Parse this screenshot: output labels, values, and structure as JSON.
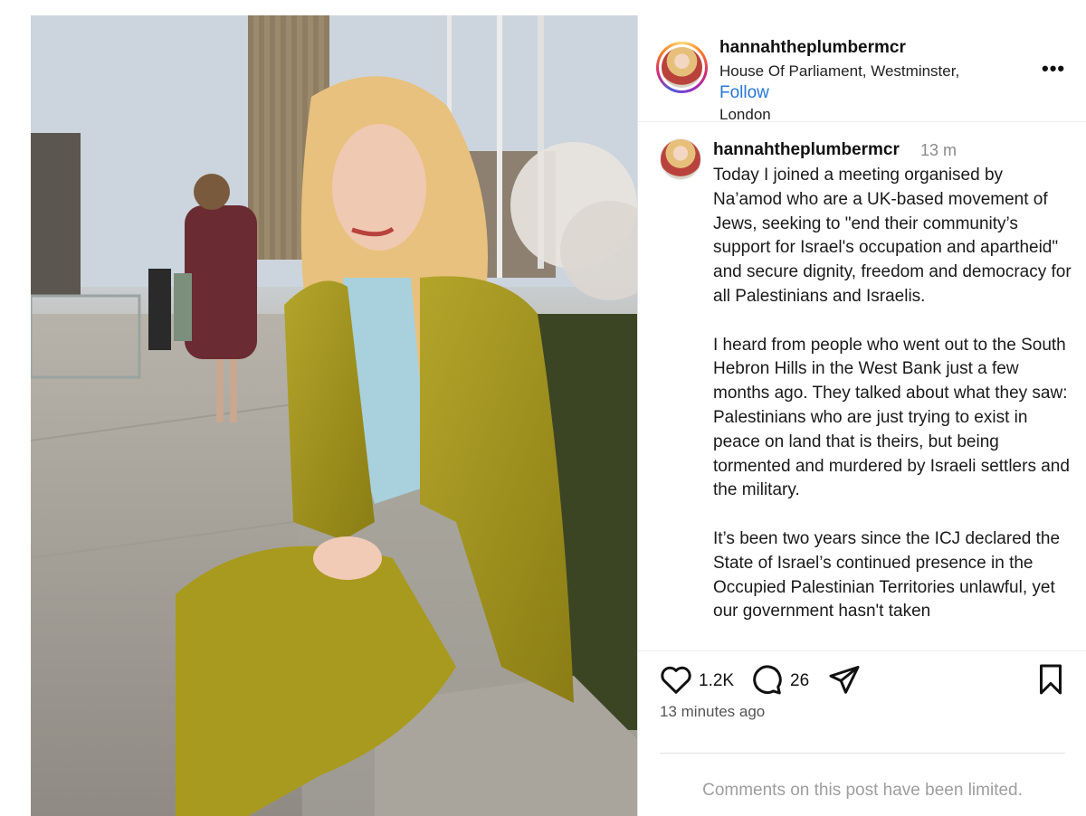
{
  "post": {
    "username": "hannahtheplumbermcr",
    "location_line1": "House Of Parliament, Westminster,",
    "location_line2": "London",
    "follow_label": "Follow",
    "more_label": "•••"
  },
  "caption": {
    "username": "hannahtheplumbermcr",
    "time": "13 m",
    "paragraphs": [
      "Today I joined a meeting organised by Na’amod who are a UK-based movement of Jews, seeking to \"end their community’s support for Israel's occupation and apartheid\" and secure dignity, freedom and democracy for all Palestinians and Israelis.",
      "I heard from people who went out to the South Hebron Hills in the West Bank just a few months ago. They talked about what they saw: Palestinians who are just trying to exist in peace on land that is theirs, but being tormented and murdered by Israeli settlers and the military.",
      "It’s been two years since the ICJ declared the State of Israel’s continued presence in the Occupied Palestinian Territories unlawful, yet our government hasn't taken"
    ]
  },
  "actions": {
    "likes": "1.2K",
    "comments": "26",
    "icons": [
      "heart-icon",
      "comment-icon",
      "share-icon",
      "bookmark-icon"
    ]
  },
  "time_ago": "13 minutes ago",
  "comments_notice": "Comments on this post have been limited.",
  "colors": {
    "follow": "#2577d8",
    "muted": "#9e9e9e"
  }
}
